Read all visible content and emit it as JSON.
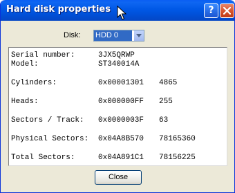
{
  "window": {
    "title": "Hard disk properties",
    "help_label": "?"
  },
  "disk_selector": {
    "label": "Disk:",
    "selected": "HDD 0"
  },
  "properties": [
    {
      "label": "Serial number:",
      "value": "3JX5QRWP",
      "value2": ""
    },
    {
      "label": "Model:",
      "value": "ST340014A",
      "value2": ""
    },
    {
      "label": "Cylinders:",
      "value": "0x00001301",
      "value2": "4865"
    },
    {
      "label": "Heads:",
      "value": "0x000000FF",
      "value2": "255"
    },
    {
      "label": "Sectors / Track:",
      "value": "0x0000003F",
      "value2": "63"
    },
    {
      "label": "Physical Sectors:",
      "value": "0x04A8B570",
      "value2": "78165360"
    },
    {
      "label": "Total Sectors:",
      "value": "0x04A891C1",
      "value2": "78156225"
    }
  ],
  "buttons": {
    "close_label": "Close"
  },
  "colors": {
    "titlebar": "#0058e6",
    "dialog_background": "#ece9d8",
    "selection": "#316ac5",
    "close_x": "#d8552f"
  },
  "icons": {
    "help": "question-mark-icon",
    "close": "close-x-icon",
    "dropdown": "chevron-down-icon",
    "cursor": "mouse-pointer-icon"
  }
}
